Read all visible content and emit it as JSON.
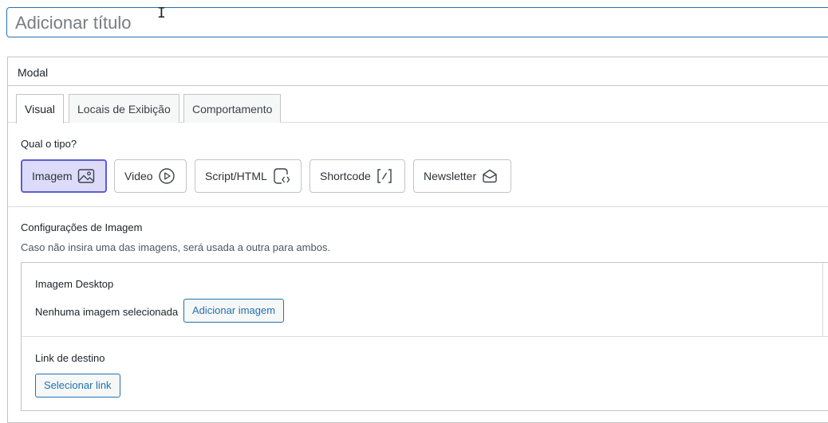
{
  "title_field": {
    "placeholder": "Adicionar título"
  },
  "metabox": {
    "title": "Modal",
    "tabs": [
      {
        "label": "Visual",
        "active": true
      },
      {
        "label": "Locais de Exibição",
        "active": false
      },
      {
        "label": "Comportamento",
        "active": false
      }
    ]
  },
  "type_section": {
    "label": "Qual o tipo?",
    "options": [
      {
        "label": "Imagem",
        "icon": "image-icon",
        "selected": true
      },
      {
        "label": "Video",
        "icon": "play-icon",
        "selected": false
      },
      {
        "label": "Script/HTML",
        "icon": "code-icon",
        "selected": false
      },
      {
        "label": "Shortcode",
        "icon": "shortcode-icon",
        "selected": false
      },
      {
        "label": "Newsletter",
        "icon": "envelope-icon",
        "selected": false
      }
    ]
  },
  "image_settings": {
    "heading": "Configurações de Imagem",
    "description": "Caso não insira uma das imagens, será usada a outra para ambos.",
    "desktop": {
      "label": "Imagem Desktop",
      "status": "Nenhuma imagem selecionada",
      "button": "Adicionar imagem"
    },
    "link": {
      "label": "Link de destino",
      "button": "Selecionar link"
    }
  },
  "colors": {
    "accent": "#2271b1",
    "selected_bg": "#dcdcfa",
    "selected_border": "#5b5fd6"
  }
}
